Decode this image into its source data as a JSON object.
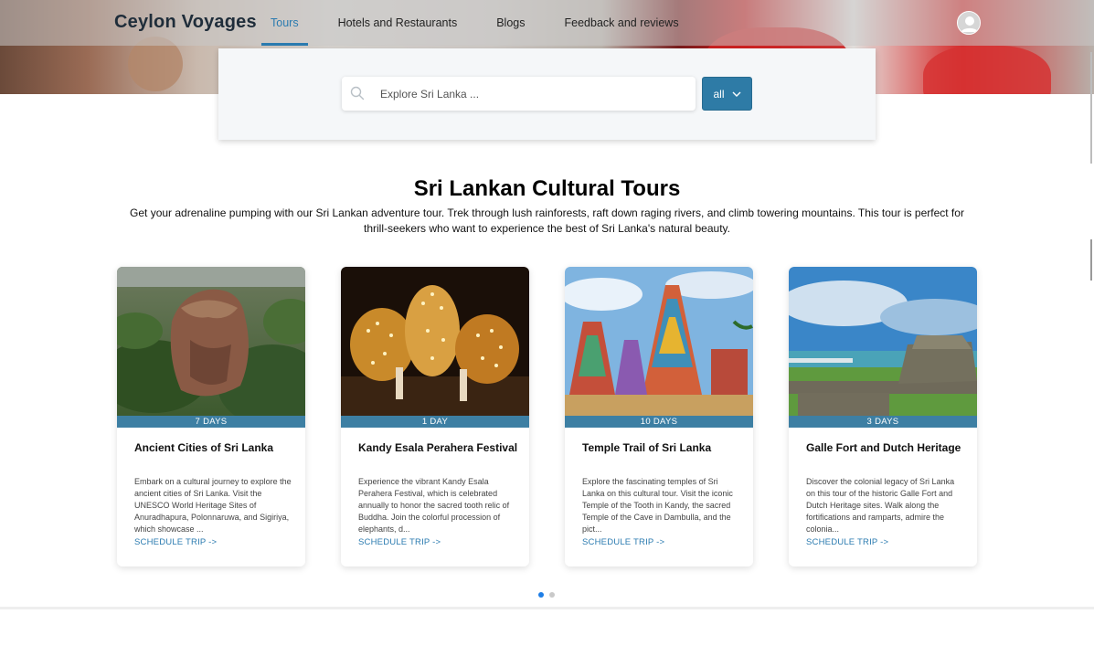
{
  "header": {
    "brand": "Ceylon Voyages",
    "nav": [
      {
        "label": "Tours",
        "active": true
      },
      {
        "label": "Hotels and Restaurants",
        "active": false
      },
      {
        "label": "Blogs",
        "active": false
      },
      {
        "label": "Feedback and reviews",
        "active": false
      }
    ],
    "avatar_icon": "user-avatar-icon"
  },
  "search": {
    "placeholder": "Explore Sri Lanka ...",
    "value": "",
    "filter_label": "all",
    "filter_icon": "chevron-down-icon"
  },
  "section": {
    "title": "Sri Lankan Cultural Tours",
    "description": "Get your adrenaline pumping with our Sri Lankan adventure tour. Trek through lush rainforests, raft down raging rivers, and climb towering mountains. This tour is perfect for thrill-seekers who want to experience the best of Sri Lanka's natural beauty."
  },
  "cards": [
    {
      "days": "7 DAYS",
      "title": "Ancient Cities of Sri Lanka",
      "text": "Embark on a cultural journey to explore the ancient cities of Sri Lanka. Visit the UNESCO World Heritage Sites of Anuradhapura, Polonnaruwa, and Sigiriya, which showcase ...",
      "link": "SCHEDULE TRIP ->"
    },
    {
      "days": "1 DAY",
      "title": "Kandy Esala Perahera Festival",
      "text": "Experience the vibrant Kandy Esala Perahera Festival, which is celebrated annually to honor the sacred tooth relic of Buddha. Join the colorful procession of elephants, d...",
      "link": "SCHEDULE TRIP ->"
    },
    {
      "days": "10 DAYS",
      "title": "Temple Trail of Sri Lanka",
      "text": "Explore the fascinating temples of Sri Lanka on this cultural tour. Visit the iconic Temple of the Tooth in Kandy, the sacred Temple of the Cave in Dambulla, and the pict...",
      "link": "SCHEDULE TRIP ->"
    },
    {
      "days": "3 DAYS",
      "title": "Galle Fort and Dutch Heritage",
      "text": "Discover the colonial legacy of Sri Lanka on this tour of the historic Galle Fort and Dutch Heritage sites. Walk along the fortifications and ramparts, admire the colonia...",
      "link": "SCHEDULE TRIP ->"
    }
  ],
  "pagination": {
    "pages": 2,
    "active": 1
  },
  "colors": {
    "accent": "#2b7bb0",
    "badge": "#3d7fa3",
    "filter_button": "#2e7ba6",
    "dot_active": "#1f7ee6"
  }
}
